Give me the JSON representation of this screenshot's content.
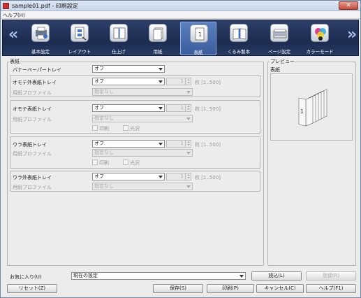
{
  "window": {
    "title": "sample01.pdf - 印刷設定",
    "close_glyph": "✕"
  },
  "menu": {
    "help": "ヘルプ(H)"
  },
  "toolbar": {
    "nav_left": "«",
    "nav_right": "»",
    "items": [
      {
        "label": "基本設定",
        "icon": "basic-settings-icon"
      },
      {
        "label": "レイアウト",
        "icon": "layout-icon"
      },
      {
        "label": "仕上げ",
        "icon": "finishing-icon"
      },
      {
        "label": "用紙",
        "icon": "paper-icon"
      },
      {
        "label": "表紙",
        "icon": "cover-icon",
        "selected": true
      },
      {
        "label": "くるみ製本",
        "icon": "perfect-binding-icon"
      },
      {
        "label": "ページ設定",
        "icon": "page-setup-icon"
      },
      {
        "label": "カラーモード",
        "icon": "color-mode-icon"
      }
    ]
  },
  "cover": {
    "group_title": "表紙",
    "banner_tray": {
      "label": "バナーペーパートレイ",
      "value": "オフ"
    },
    "front_outer": {
      "label": "オモテ外表紙トレイ",
      "value": "オフ",
      "count": "1",
      "range": "枚 [1..500]",
      "profile_label": "用紙プロファイル",
      "profile_value": "指定なし"
    },
    "front_inner": {
      "label": "オモテ表紙トレイ",
      "value": "オフ",
      "count": "1",
      "range": "枚 [1..500]",
      "profile_label": "用紙プロファイル",
      "profile_value": "指定なし",
      "print_label": "印刷",
      "gloss_label": "光沢"
    },
    "back_inner": {
      "label": "ウラ表紙トレイ",
      "value": "オフ",
      "count": "1",
      "range": "枚 [1..500]",
      "profile_label": "用紙プロファイル",
      "profile_value": "指定なし",
      "print_label": "印刷",
      "gloss_label": "光沢"
    },
    "back_outer": {
      "label": "ウラ外表紙トレイ",
      "value": "オフ",
      "count": "1",
      "range": "枚 [1..500]",
      "profile_label": "用紙プロファイル",
      "profile_value": "指定なし"
    }
  },
  "preview": {
    "group_title": "プレビュー",
    "caption": "表紙",
    "page_number": "1"
  },
  "favorites": {
    "label": "お気に入り(U)",
    "value": "現在の設定",
    "load": "読込(L)",
    "register": "登録(R)"
  },
  "footer": {
    "reset": "リセット(Z)",
    "save": "保存(S)",
    "print": "印刷(P)",
    "cancel": "キャンセル(C)",
    "help": "ヘルプ(F1)"
  }
}
